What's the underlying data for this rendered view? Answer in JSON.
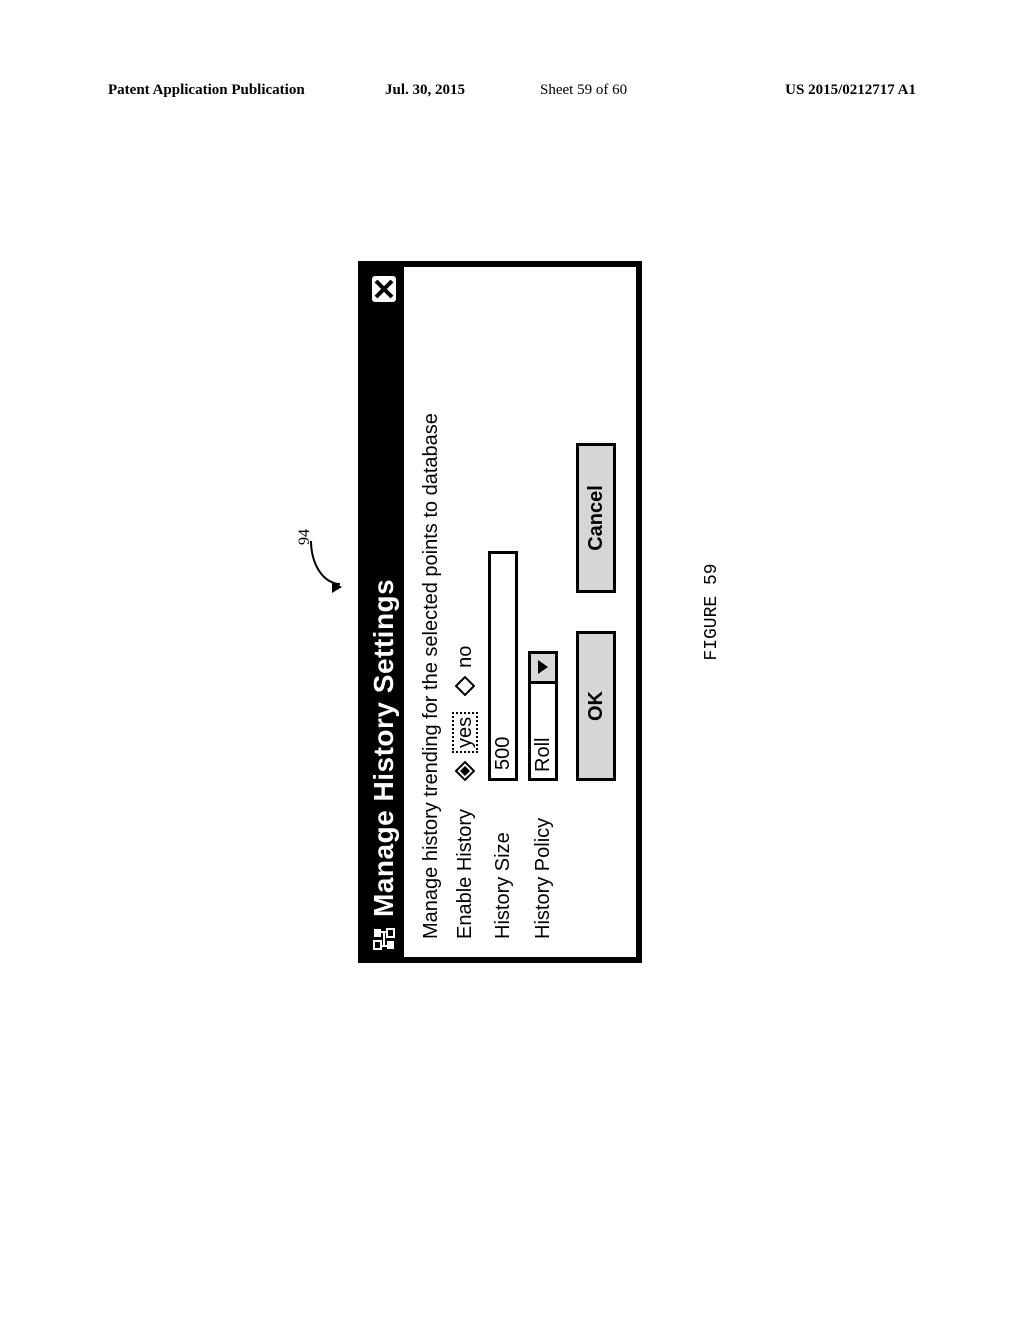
{
  "page_header": {
    "left": "Patent Application Publication",
    "date": "Jul. 30, 2015",
    "sheet": "Sheet 59 of 60",
    "right": "US 2015/0212717 A1"
  },
  "reference_number": "94",
  "dialog": {
    "title": "Manage History Settings",
    "description": "Manage history trending for the selected points to database",
    "enable_history": {
      "label": "Enable History",
      "options": {
        "yes": "yes",
        "no": "no"
      },
      "selected": "yes"
    },
    "history_size": {
      "label": "History Size",
      "value": "500"
    },
    "history_policy": {
      "label": "History Policy",
      "value": "Roll"
    },
    "buttons": {
      "ok": "OK",
      "cancel": "Cancel"
    }
  },
  "figure_caption": "FIGURE 59"
}
